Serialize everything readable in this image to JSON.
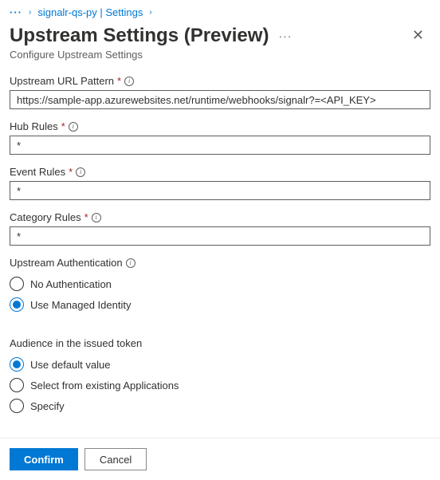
{
  "breadcrumb": {
    "ellipsis": "···",
    "item1": "signalr-qs-py | Settings"
  },
  "header": {
    "title": "Upstream Settings (Preview)",
    "subtitle": "Configure Upstream Settings"
  },
  "fields": {
    "urlPattern": {
      "label": "Upstream URL Pattern",
      "value": "https://sample-app.azurewebsites.net/runtime/webhooks/signalr?=<API_KEY>"
    },
    "hubRules": {
      "label": "Hub Rules",
      "value": "*"
    },
    "eventRules": {
      "label": "Event Rules",
      "value": "*"
    },
    "categoryRules": {
      "label": "Category Rules",
      "value": "*"
    }
  },
  "auth": {
    "label": "Upstream Authentication",
    "options": {
      "none": "No Authentication",
      "managed": "Use Managed Identity"
    },
    "selected": "managed"
  },
  "audience": {
    "label": "Audience in the issued token",
    "options": {
      "default": "Use default value",
      "existing": "Select from existing Applications",
      "specify": "Specify"
    },
    "selected": "default"
  },
  "footer": {
    "confirm": "Confirm",
    "cancel": "Cancel"
  },
  "glyphs": {
    "required": "*",
    "chevron": "›",
    "info": "i",
    "more": "···",
    "close": "✕"
  }
}
